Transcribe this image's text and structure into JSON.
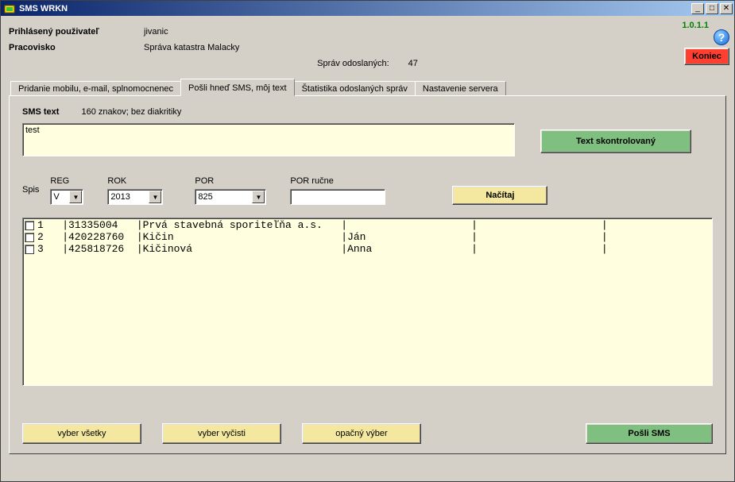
{
  "window": {
    "title": "SMS WRKN"
  },
  "version": "1.0.1.1",
  "help_tooltip": "?",
  "koniec_label": "Koniec",
  "header": {
    "user_label": "Prihlásený použivateľ",
    "user_value": "jivanic",
    "workplace_label": "Pracovisko",
    "workplace_value": "Správa katastra Malacky",
    "sent_label": "Správ odoslaných:",
    "sent_value": "47"
  },
  "tabs": {
    "t1": "Pridanie mobilu, e-mail, splnomocnenec",
    "t2": "Pošli hneď SMS, môj text",
    "t3": "Štatistika odoslaných správ",
    "t4": "Nastavenie servera"
  },
  "sms": {
    "label": "SMS text",
    "hint": "160 znakov;  bez diakritiky",
    "value": "test",
    "checked_label": "Text skontrolovaný"
  },
  "spis": {
    "label": "Spis",
    "reg_label": "REG",
    "reg_value": "V",
    "rok_label": "ROK",
    "rok_value": "2013",
    "por_label": "POR",
    "por_value": "825",
    "por_rucne_label": "POR ručne",
    "por_rucne_value": "",
    "nacitaj_label": "Načítaj"
  },
  "list": {
    "rows": [
      {
        "n": "1",
        "col1": "31335004",
        "col2": "Prvá stavebná sporiteľňa a.s.",
        "col3": "",
        "col4": ""
      },
      {
        "n": "2",
        "col1": "420228760",
        "col2": "Kičin",
        "col3": "Ján",
        "col4": ""
      },
      {
        "n": "3",
        "col1": "425818726",
        "col2": "Kičinová",
        "col3": "Anna",
        "col4": ""
      }
    ]
  },
  "buttons": {
    "select_all": "vyber všetky",
    "select_clear": "vyber vyčisti",
    "select_invert": "opačný výber",
    "send": "Pošli SMS"
  }
}
